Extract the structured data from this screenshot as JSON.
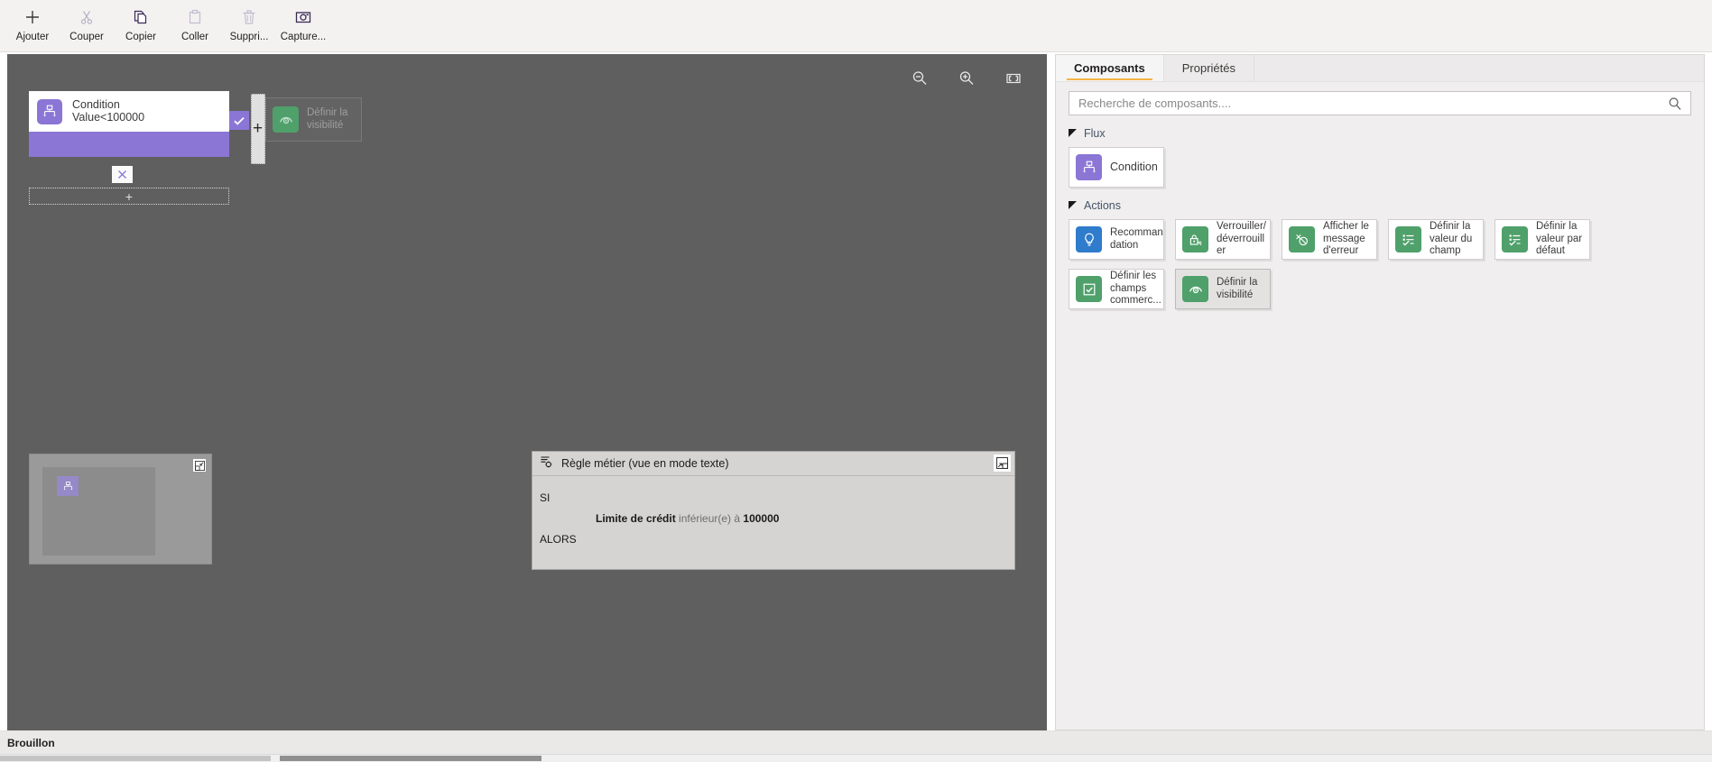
{
  "colors": {
    "accent_purple": "#8b76d6",
    "accent_green": "#4fa06a",
    "accent_blue": "#2f7bcc",
    "tab_underline": "#f2b443",
    "canvas_bg": "#5f5f5f",
    "group_title": "#44546a"
  },
  "toolbar": {
    "items": [
      {
        "label": "Ajouter",
        "icon": "plus-icon"
      },
      {
        "label": "Couper",
        "icon": "scissors-icon"
      },
      {
        "label": "Copier",
        "icon": "copy-icon"
      },
      {
        "label": "Coller",
        "icon": "paste-icon"
      },
      {
        "label": "Suppri...",
        "icon": "trash-icon"
      },
      {
        "label": "Capture...",
        "icon": "camera-icon"
      }
    ]
  },
  "canvas": {
    "zoom_controls": [
      {
        "name": "zoom-out-icon",
        "title": "Zoom arrière"
      },
      {
        "name": "zoom-in-icon",
        "title": "Zoom avant"
      },
      {
        "name": "fit-to-screen-icon",
        "title": "Ajuster à l'écran"
      }
    ],
    "condition_node": {
      "title": "Condition",
      "subtitle": "Value<100000",
      "icon": "condition-icon",
      "close_label": "✕",
      "check_label": "✓"
    },
    "add_step": {
      "label": "+"
    },
    "drag_ghost": {
      "label": "Définir la visibilité",
      "icon": "visibility-icon"
    },
    "drop_plus": "+",
    "minimap": {
      "node_icon": "condition-icon",
      "collapse_icon": "collapse-icon"
    }
  },
  "rule_panel": {
    "title": "Règle métier (vue en mode texte)",
    "head_icon": "rule-settings-icon",
    "expand_icon": "expand-icon",
    "if_label": "SI",
    "then_label": "ALORS",
    "condition": {
      "field": "Limite de crédit",
      "operator": "inférieur(e) à",
      "value": "100000"
    }
  },
  "right_panel": {
    "tabs": [
      {
        "label": "Composants",
        "active": true
      },
      {
        "label": "Propriétés",
        "active": false
      }
    ],
    "search": {
      "value": "",
      "placeholder": "Recherche de composants...."
    },
    "groups": [
      {
        "title": "Flux",
        "expanded": true,
        "items": [
          {
            "label": "Condition",
            "icon": "condition-icon",
            "color": "purple",
            "selected": false
          }
        ]
      },
      {
        "title": "Actions",
        "expanded": true,
        "items": [
          {
            "label": "Recommandation",
            "icon": "lightbulb-icon",
            "color": "blue",
            "selected": false
          },
          {
            "label": "Verrouiller/déverrouiller",
            "icon": "lock-icon",
            "color": "green",
            "selected": false
          },
          {
            "label": "Afficher le message d'erreur",
            "icon": "error-message-icon",
            "color": "green",
            "selected": false
          },
          {
            "label": "Définir la valeur du champ",
            "icon": "set-field-value-icon",
            "color": "green",
            "selected": false
          },
          {
            "label": "Définir la valeur par défaut",
            "icon": "set-default-value-icon",
            "color": "green",
            "selected": false
          },
          {
            "label": "Définir les champs commerc...",
            "icon": "business-fields-icon",
            "color": "green",
            "selected": false
          },
          {
            "label": "Définir la visibilité",
            "icon": "visibility-icon",
            "color": "green",
            "selected": true
          }
        ]
      }
    ]
  },
  "statusbar": {
    "text": "Brouillon"
  }
}
